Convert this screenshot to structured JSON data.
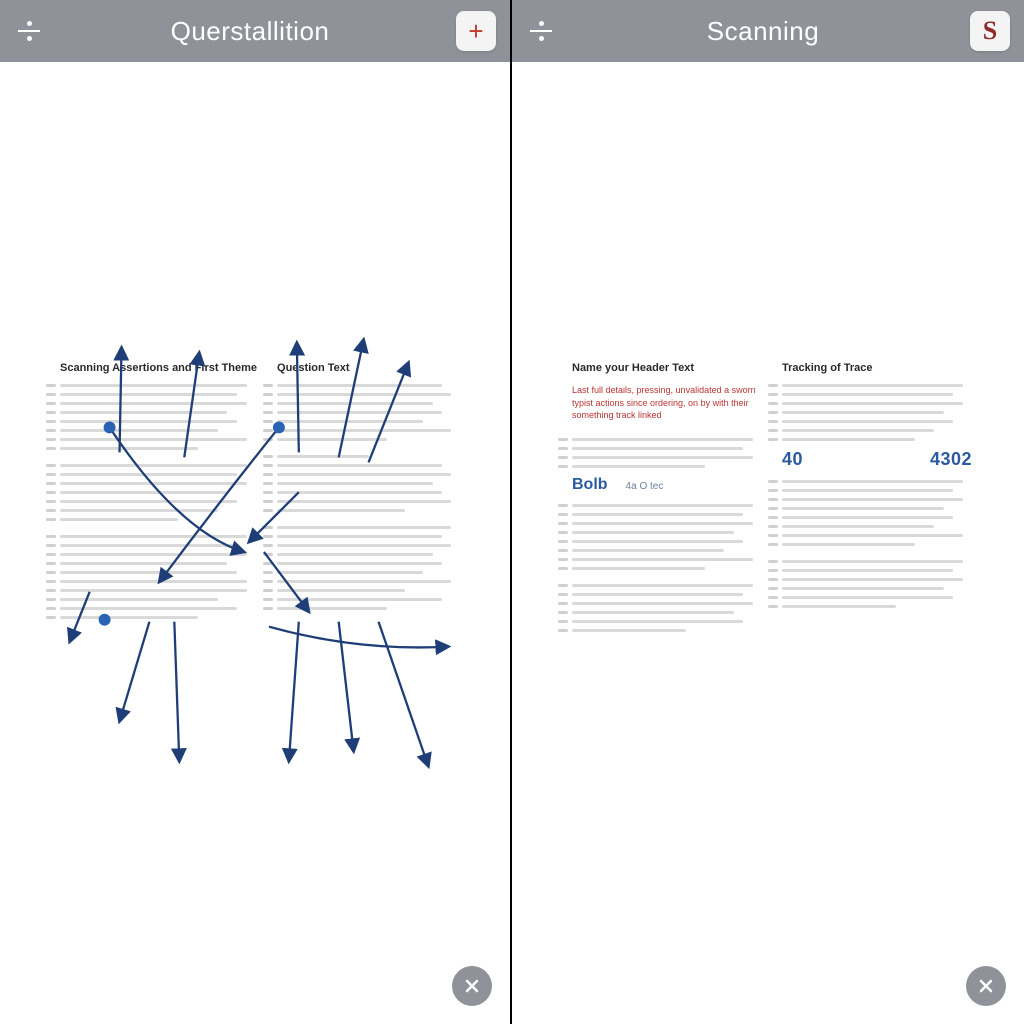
{
  "left": {
    "title": "Querstallition",
    "menu_icon": "divide-icon",
    "action_icon": "plus-icon",
    "doc": {
      "col1_head": "Scanning Assertions and First Theme",
      "col2_head": "Question Text"
    }
  },
  "right": {
    "title": "Scanning",
    "menu_icon": "divide-icon",
    "action_icon": "s-icon",
    "doc": {
      "col1_head": "Name your Header Text",
      "col1_sub": "Last full details, pressing, unvalidated a sworn typist actions since ordering, on by with their something track linked",
      "col2_head": "Tracking of Trace",
      "stats": {
        "label": "Bolb",
        "small1": "4a O tec",
        "num1": "40",
        "num2": "4302"
      }
    }
  },
  "close_label": "close"
}
